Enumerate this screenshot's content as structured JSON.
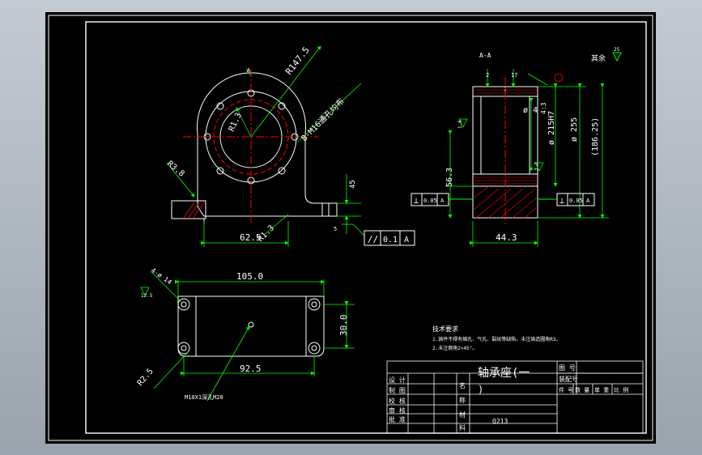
{
  "colors": {
    "line": "#ffffff",
    "green": "#00ff00",
    "red": "#ff0000",
    "yellow": "#ffff00",
    "text": "#ffffff"
  },
  "top_view": {
    "section_mark": "A",
    "r_outer": "R147.5",
    "r_hole": "R1.3",
    "holes_note": "8-M16通孔均布",
    "r_fillet": "R3.8",
    "dim_width": "62.5",
    "r_base": "R1.3",
    "dim_45": "45",
    "dim_5": "5",
    "parallel_symbol": "//",
    "parallel_tol": "0.1",
    "parallel_ref": "A"
  },
  "section_view": {
    "title": "A-A",
    "roughness_other": "其余",
    "roughness_value": "25",
    "dim_top_left": "2",
    "dim_top_right": "17",
    "dim_d4": "ø 4",
    "angle": "4:3",
    "dim_d215": "ø 215H7",
    "dim_d255": "ø 255",
    "dim_186": "(186.25)",
    "dim_56": "56.3",
    "dim_44": "44.3",
    "rough_a": "1.6",
    "rough_b": "3.2",
    "perp_left_symbol": "⊥",
    "perp_left_tol": "0.05",
    "perp_left_ref": "A",
    "perp_right_symbol": "⊥",
    "perp_right_tol": "0.05",
    "perp_right_ref": "A"
  },
  "bottom_view": {
    "holes_note": "4-ø 14",
    "rough_value": "12.5",
    "dim_105": "105.0",
    "dim_30": "30.0",
    "dim_92": "92.5",
    "r_corner": "R2.5",
    "thread_note": "M10X1深孔M20"
  },
  "tech_notes": {
    "heading": "技术要求",
    "line1": "1.铸件不得有缩孔、气孔、裂纹等缺陷，未注铸造圆角R3。",
    "line2": "2.未注倒角2×45°。"
  },
  "title_block": {
    "part_name": "轴承座(一",
    "part_name_tail": ")",
    "row_design": "设 计",
    "row_draw": "制 图",
    "row_check": "校 核",
    "row_review": "审 核",
    "row_approve": "批 准",
    "label_name": "名",
    "label_name2": "称",
    "label_material": "材",
    "label_material2": "料",
    "material_value": "Q213",
    "label_drawing_no": "图 号",
    "label_assembly_no": "装配号",
    "col_count": "件 号",
    "col_qty": "数 量",
    "col_weight": "单 重",
    "col_ratio": "比 例"
  }
}
